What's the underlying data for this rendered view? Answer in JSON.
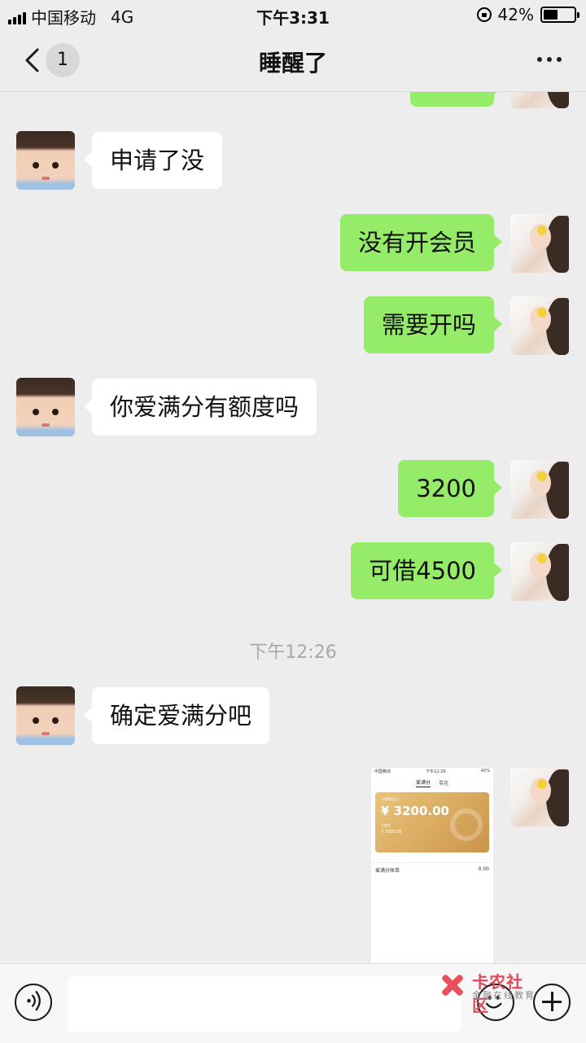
{
  "status_bar": {
    "carrier": "中国移动",
    "network": "4G",
    "time": "下午3:31",
    "battery": "42%"
  },
  "header": {
    "unread_count": "1",
    "title": "睡醒了"
  },
  "messages": [
    {
      "side": "in",
      "text": "申请了没"
    },
    {
      "side": "out",
      "text": "没有开会员"
    },
    {
      "side": "out",
      "text": "需要开吗"
    },
    {
      "side": "in",
      "text": "你爱满分有额度吗"
    },
    {
      "side": "out",
      "text": "3200"
    },
    {
      "side": "out",
      "text": "可借4500"
    },
    {
      "type": "timestamp",
      "text": "下午12:26"
    },
    {
      "side": "in",
      "text": "确定爱满分吧"
    },
    {
      "side": "out",
      "type": "image",
      "description_visible": {
        "status_carrier": "中国移动",
        "status_time": "下午12:26",
        "status_battery": "42%",
        "tab_active": "爱满分",
        "tab_other": "零花",
        "card_label": "可用额度(元)",
        "card_amount": "¥ 3200.00",
        "card_sub_label": "总额度",
        "card_sub_amount": "¥ 3200.00",
        "row_label": "爱满分账单",
        "row_value": "0.00"
      }
    }
  ],
  "watermark": {
    "title": "卡农社区",
    "subtitle": "金融在线教育"
  },
  "colors": {
    "background": "#ededed",
    "outgoing_bubble": "#95ec69",
    "incoming_bubble": "#ffffff",
    "watermark_red": "#e04a58"
  },
  "icons": [
    "back-chevron-icon",
    "more-dots-icon",
    "voice-icon",
    "emoji-icon",
    "plus-icon",
    "lock-rotation-icon",
    "battery-icon",
    "signal-icon"
  ]
}
